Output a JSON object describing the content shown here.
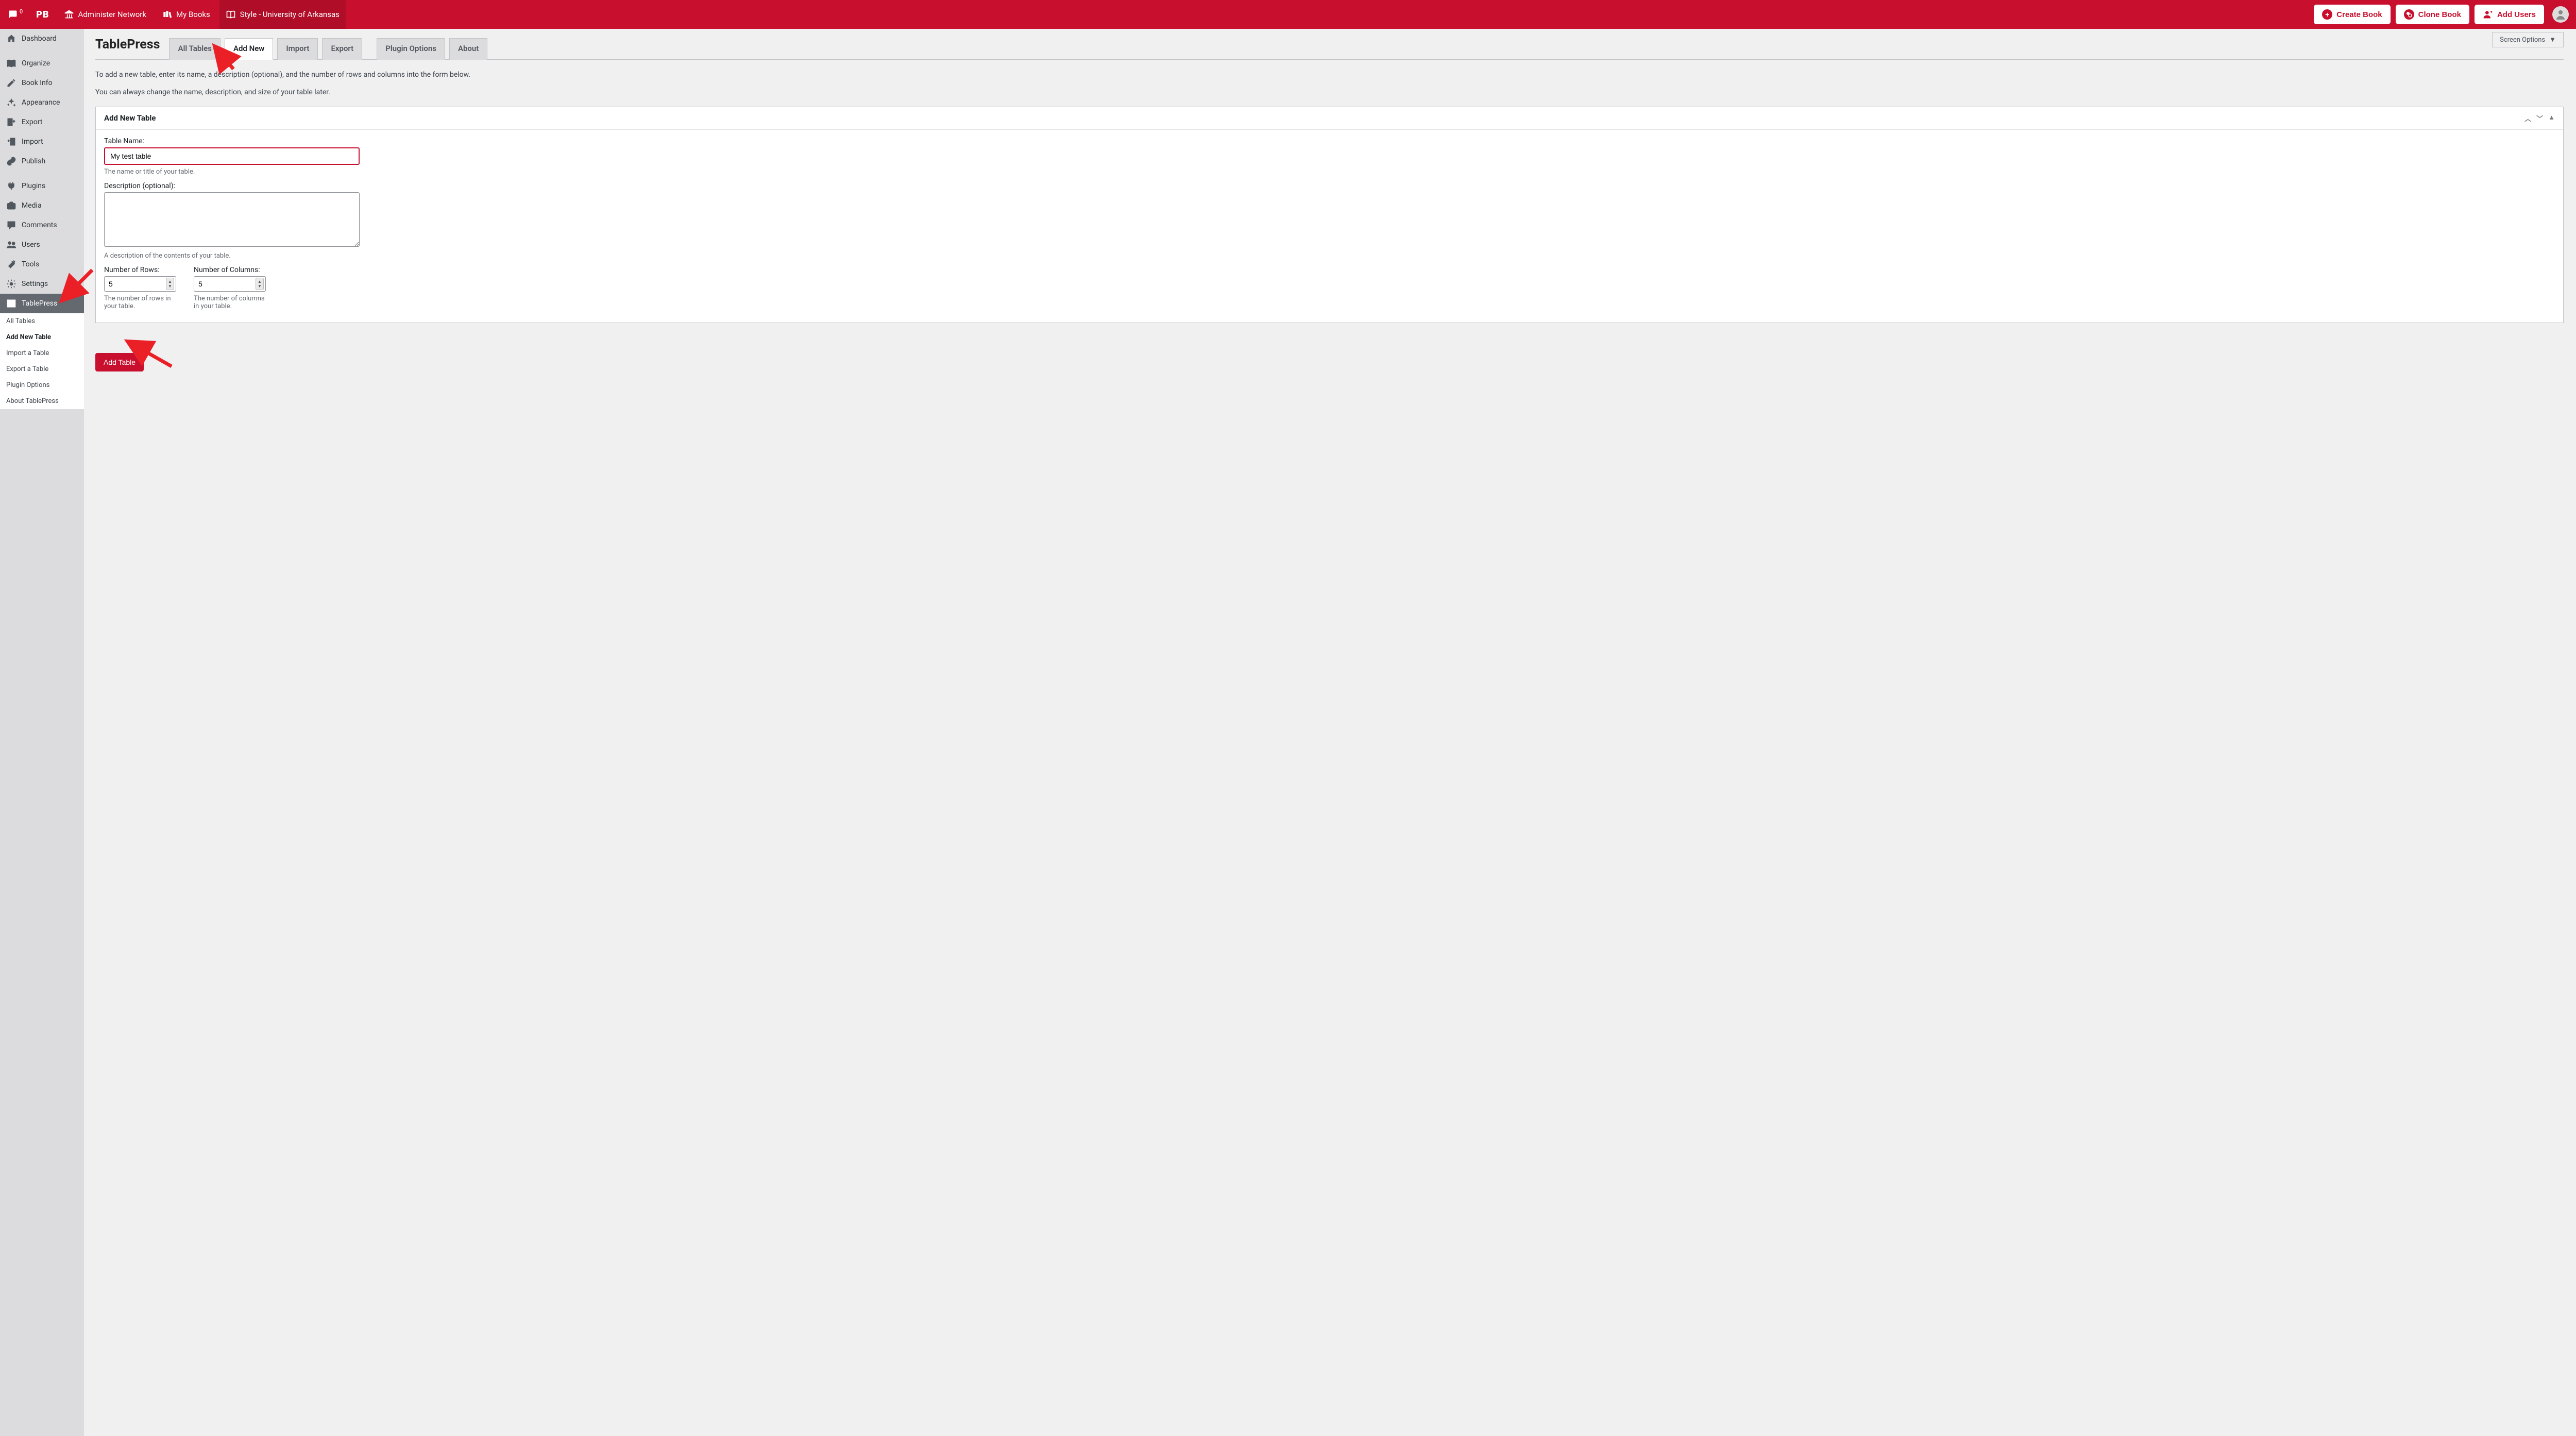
{
  "topbar": {
    "notification_count": "0",
    "pb_logo": "PB",
    "admin_network": "Administer Network",
    "my_books": "My Books",
    "current_book": "Style - University of Arkansas",
    "create_book": "Create Book",
    "clone_book": "Clone Book",
    "add_users": "Add Users"
  },
  "sidebar": {
    "dashboard": "Dashboard",
    "organize": "Organize",
    "book_info": "Book Info",
    "appearance": "Appearance",
    "export": "Export",
    "import": "Import",
    "publish": "Publish",
    "plugins": "Plugins",
    "media": "Media",
    "comments": "Comments",
    "users": "Users",
    "tools": "Tools",
    "settings": "Settings",
    "tablepress": "TablePress",
    "sub": {
      "all_tables": "All Tables",
      "add_new": "Add New Table",
      "import": "Import a Table",
      "export": "Export a Table",
      "options": "Plugin Options",
      "about": "About TablePress"
    }
  },
  "main": {
    "screen_options": "Screen Options",
    "page_title": "TablePress",
    "tabs": {
      "all": "All Tables",
      "add": "Add New",
      "import": "Import",
      "export": "Export",
      "options": "Plugin Options",
      "about": "About"
    },
    "intro1": "To add a new table, enter its name, a description (optional), and the number of rows and columns into the form below.",
    "intro2": "You can always change the name, description, and size of your table later.",
    "panel": {
      "title": "Add New Table",
      "table_name_label": "Table Name:",
      "table_name_value": "My test table",
      "table_name_help": "The name or title of your table.",
      "desc_label": "Description (optional):",
      "desc_value": "",
      "desc_help": "A description of the contents of your table.",
      "rows_label": "Number of Rows:",
      "rows_value": "5",
      "rows_help": "The number of rows in your table.",
      "cols_label": "Number of Columns:",
      "cols_value": "5",
      "cols_help": "The number of columns in your table."
    },
    "add_button": "Add Table"
  }
}
